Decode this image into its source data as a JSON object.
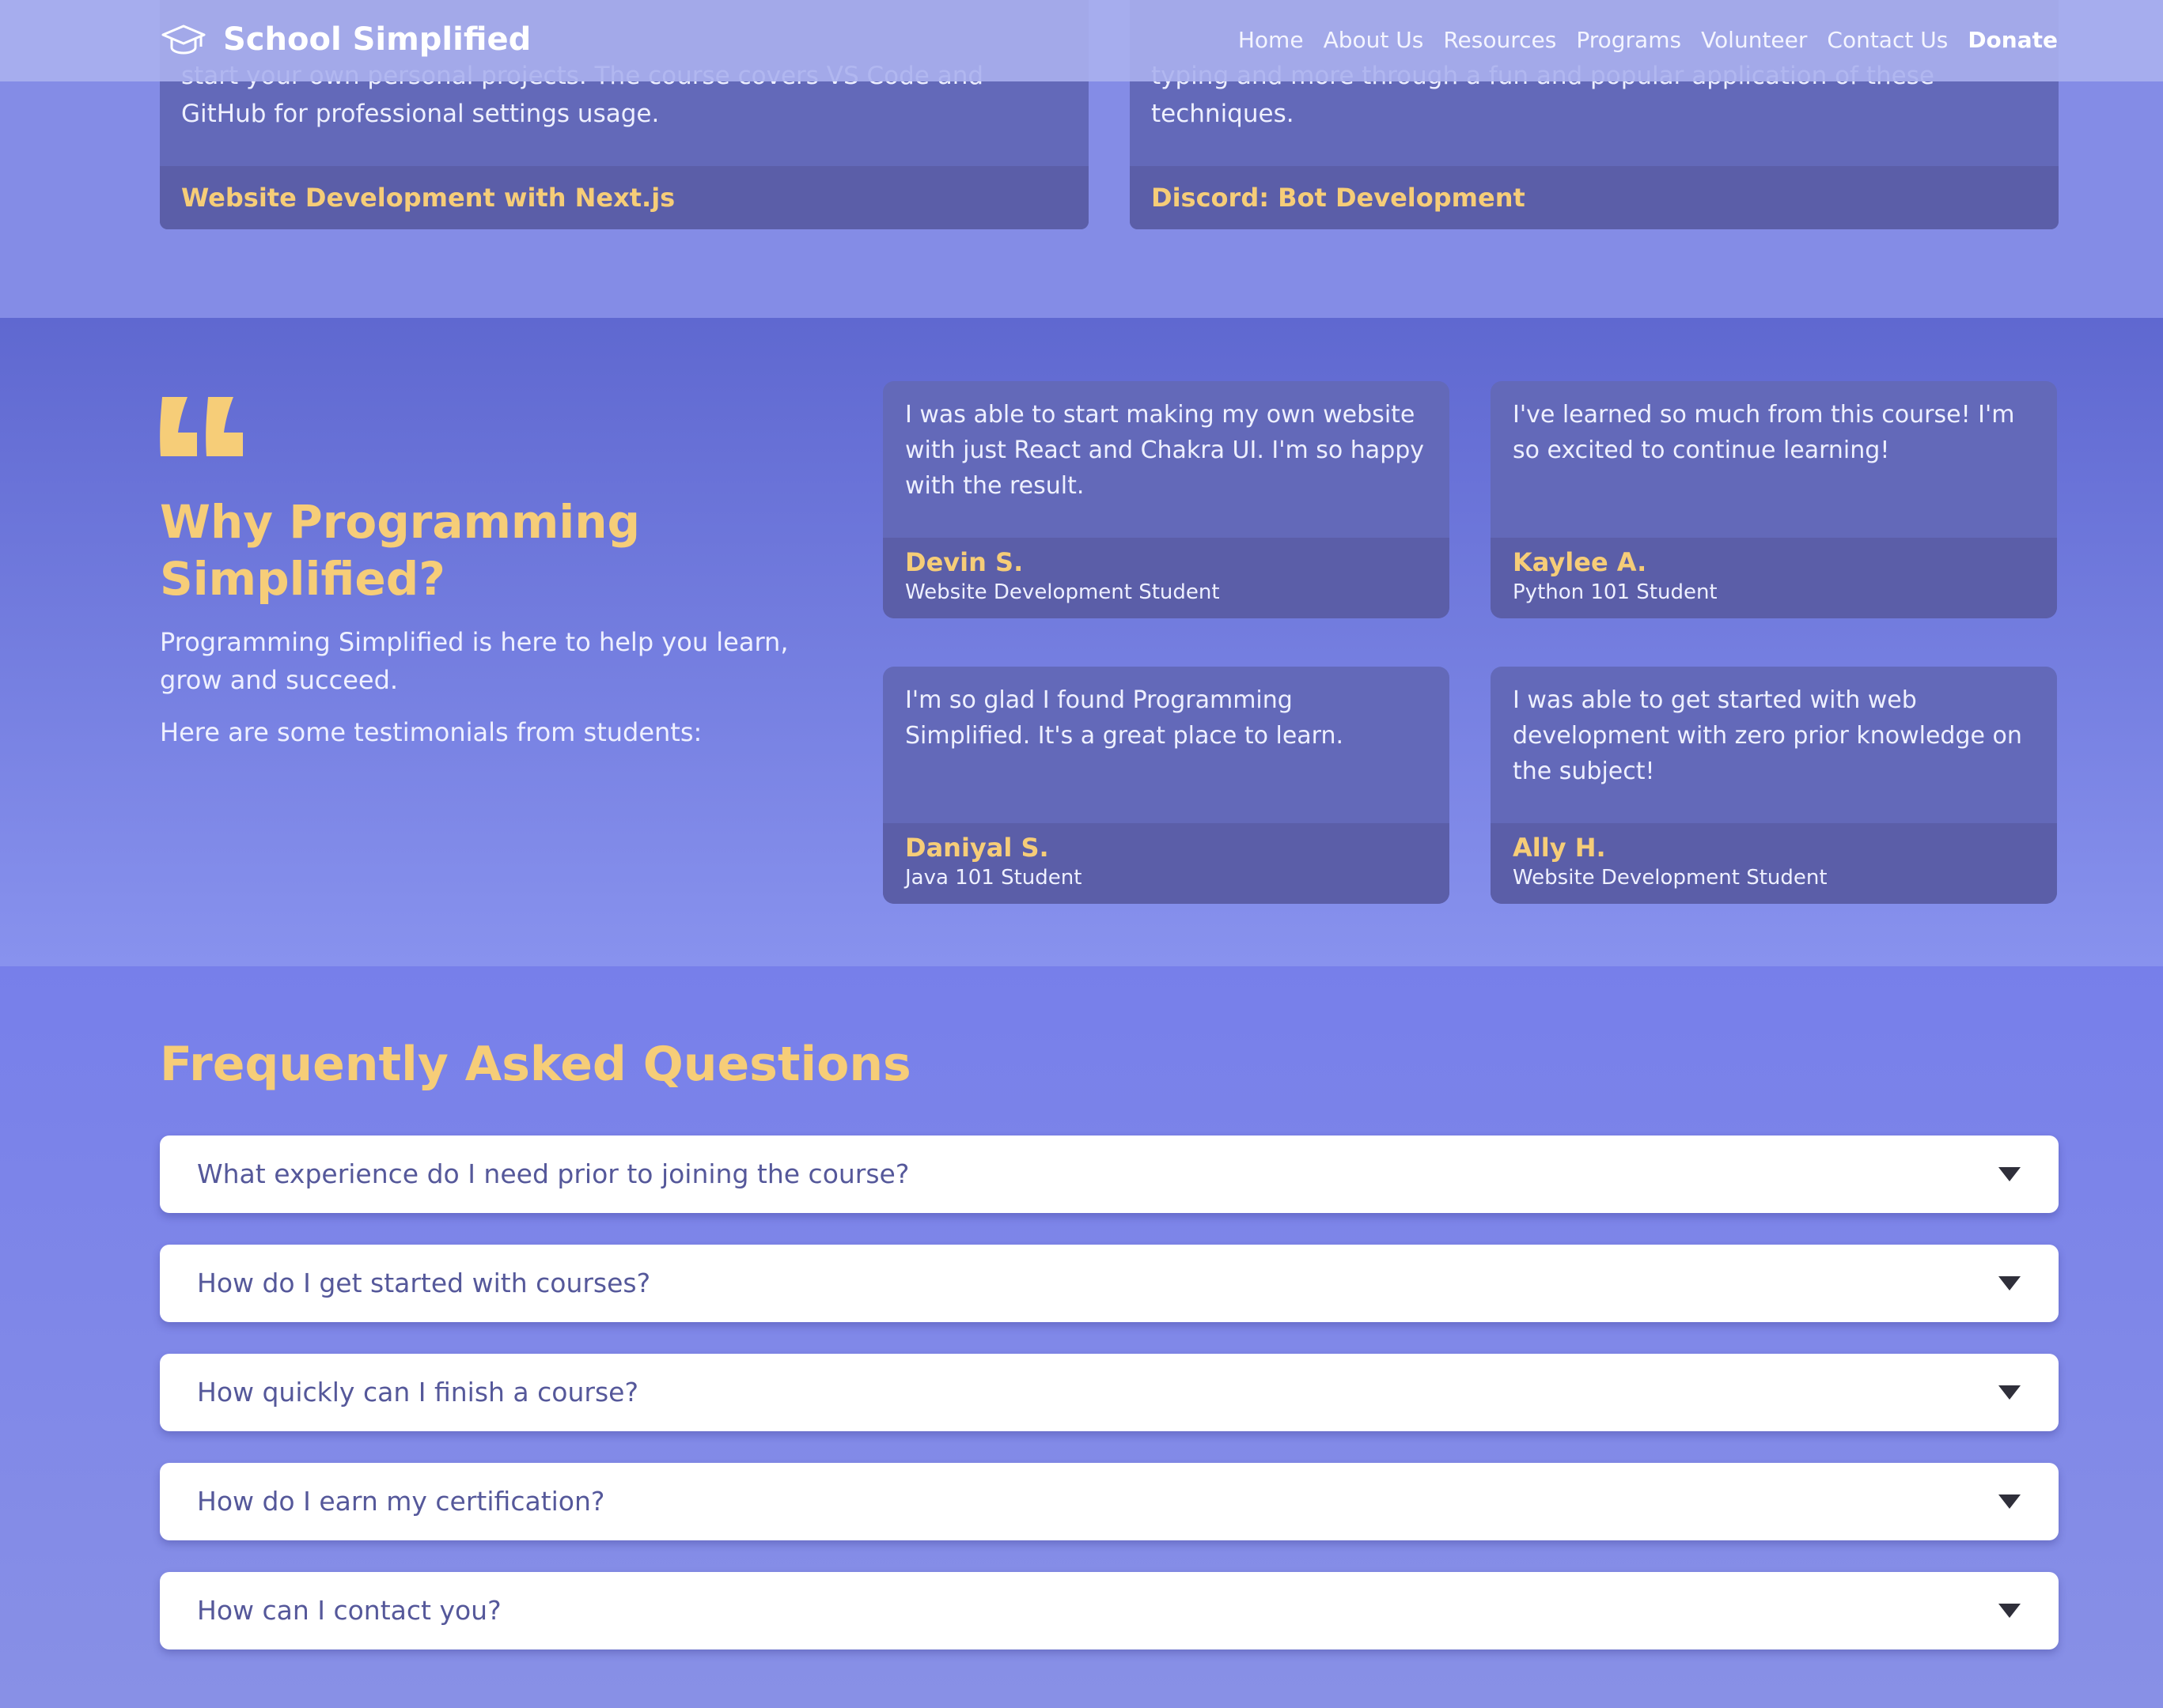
{
  "brand": {
    "name": "School Simplified",
    "icon": "graduation-cap-icon"
  },
  "nav": {
    "items": [
      {
        "label": "Home"
      },
      {
        "label": "About Us"
      },
      {
        "label": "Resources"
      },
      {
        "label": "Programs"
      },
      {
        "label": "Volunteer"
      },
      {
        "label": "Contact Us"
      },
      {
        "label": "Donate"
      }
    ]
  },
  "courses": [
    {
      "desc_lines": [
        "start your own personal projects. The course covers VS Code and",
        "GitHub for professional settings usage."
      ],
      "title": "Website Development with Next.js"
    },
    {
      "desc_lines": [
        "typing and more through a fun and popular application of these",
        "techniques."
      ],
      "title": "Discord: Bot Development"
    }
  ],
  "why": {
    "quote_icon": "quote-icon",
    "title_lines": [
      "Why Programming",
      "Simplified?"
    ],
    "desc_lines": [
      "Programming Simplified is here to help you learn,",
      "grow and succeed."
    ],
    "sub": "Here are some testimonials from students:"
  },
  "testimonials": [
    {
      "quote_lines": [
        "I was able to start making my own website",
        "with just React and Chakra UI. I'm so happy",
        "with the result."
      ],
      "name": "Devin S.",
      "role": "Website Development Student"
    },
    {
      "quote_lines": [
        "I've learned so much from this course! I'm",
        "so excited to continue learning!"
      ],
      "name": "Kaylee A.",
      "role": "Python 101 Student"
    },
    {
      "quote_lines": [
        "I'm so glad I found Programming",
        "Simplified. It's a great place to learn."
      ],
      "name": "Daniyal S.",
      "role": "Java 101 Student"
    },
    {
      "quote_lines": [
        "I was able to get started with web",
        "development with zero prior knowledge on",
        "the subject!"
      ],
      "name": "Ally H.",
      "role": "Website Development Student"
    }
  ],
  "faq": {
    "title": "Frequently Asked Questions",
    "items": [
      {
        "question": "What experience do I need prior to joining the course?",
        "icon": "chevron-down-icon"
      },
      {
        "question": "How do I get started with courses?",
        "icon": "chevron-down-icon"
      },
      {
        "question": "How quickly can I finish a course?",
        "icon": "chevron-down-icon"
      },
      {
        "question": "How do I earn my certification?",
        "icon": "chevron-down-icon"
      },
      {
        "question": "How can I contact you?",
        "icon": "chevron-down-icon"
      }
    ]
  },
  "colors": {
    "accent": "#f6cd78",
    "card": "#6369b9",
    "card_footer": "#5b5ea8",
    "faq_text": "#55589a"
  }
}
